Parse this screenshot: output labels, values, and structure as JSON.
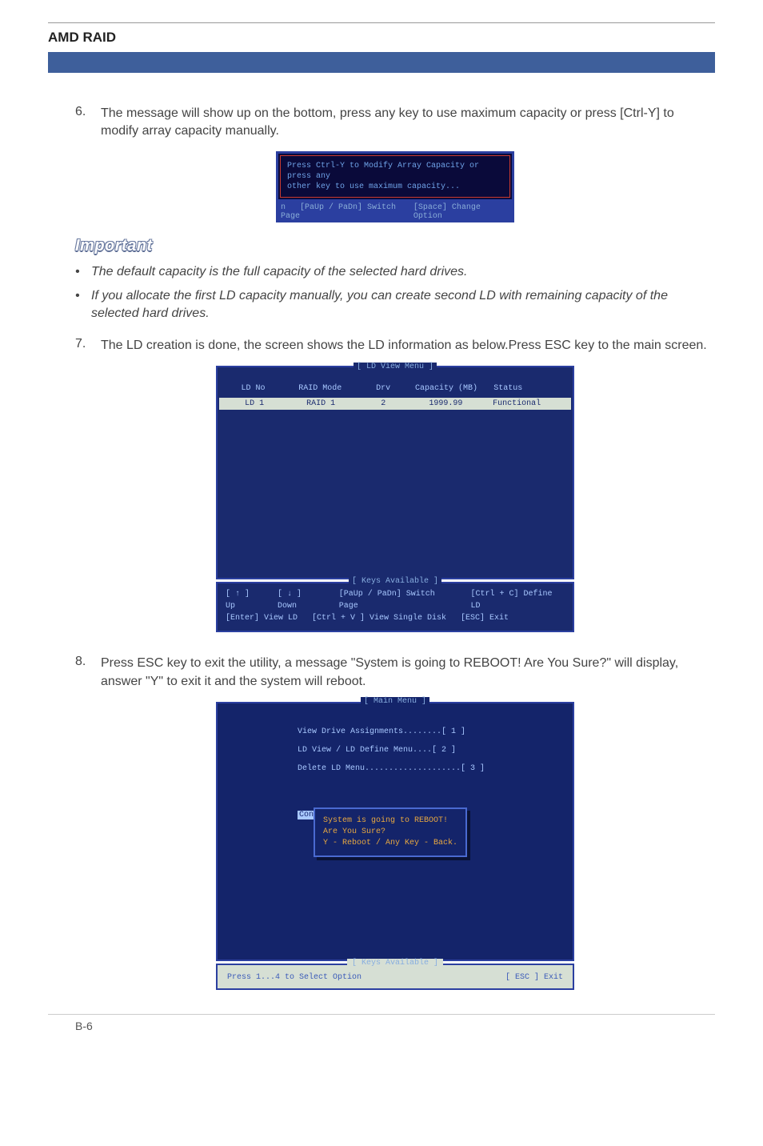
{
  "header": {
    "title": "AMD RAID"
  },
  "steps": {
    "s6": {
      "num": "6.",
      "text": "The message will show up on the bottom, press any key to use maximum capacity or press [Ctrl-Y] to modify array capacity manually."
    },
    "s7": {
      "num": "7.",
      "text": "The LD creation is done, the screen shows the LD information as below.Press ESC key to the main screen."
    },
    "s8": {
      "num": "8.",
      "text": "Press ESC key to exit the utility, a message \"System is going to REBOOT! Are You Sure?\" will display, answer \"Y\" to exit it and the system will reboot."
    }
  },
  "ss1": {
    "line1": "Press Ctrl-Y to Modify Array Capacity or press any",
    "line2": "other key to use maximum capacity...",
    "foot_left_pre": "n",
    "foot_left": "[PaUp / PaDn] Switch Page",
    "foot_right": "[Space] Change Option"
  },
  "important": {
    "heading": "Important",
    "b1": "The default capacity is the full capacity of the selected hard drives.",
    "b2": "If you allocate the first LD capacity manually, you can create second LD with remaining capacity of the selected hard drives."
  },
  "ldview": {
    "title": "[ LD View Menu ]",
    "h1": "LD No",
    "h2": "RAID Mode",
    "h3": "Drv",
    "h4": "Capacity (MB)",
    "h5": "Status",
    "r1c1": "LD   1",
    "r1c2": "RAID 1",
    "r1c3": "2",
    "r1c4": "1999.99",
    "r1c5": "Functional",
    "keys_title": "[ Keys Available ]",
    "k1": "[ ↑ ] Up",
    "k2": "[ ↓ ] Down",
    "k3": "[PaUp / PaDn] Switch Page",
    "k4": "[Ctrl + C] Define LD",
    "k5": "[Enter] View LD",
    "k6": "[Ctrl + V ] View Single Disk",
    "k7": "[ESC] Exit"
  },
  "mainmenu": {
    "title": "[ Main Menu ]",
    "m1": "View Drive Assignments........[ 1 ]",
    "m2": "LD View / LD Define Menu....[ 2 ]",
    "m3": "Delete LD Menu....................[ 3 ]",
    "con": "Con",
    "d1": "System is going to REBOOT!",
    "d2": "Are You Sure?",
    "d3": "Y - Reboot / Any Key - Back.",
    "keys_title": "[ Keys Available ]",
    "k_left": "Press 1...4 to Select Option",
    "k_right": "[ ESC ]   Exit"
  },
  "footer": {
    "page": "B-6"
  }
}
